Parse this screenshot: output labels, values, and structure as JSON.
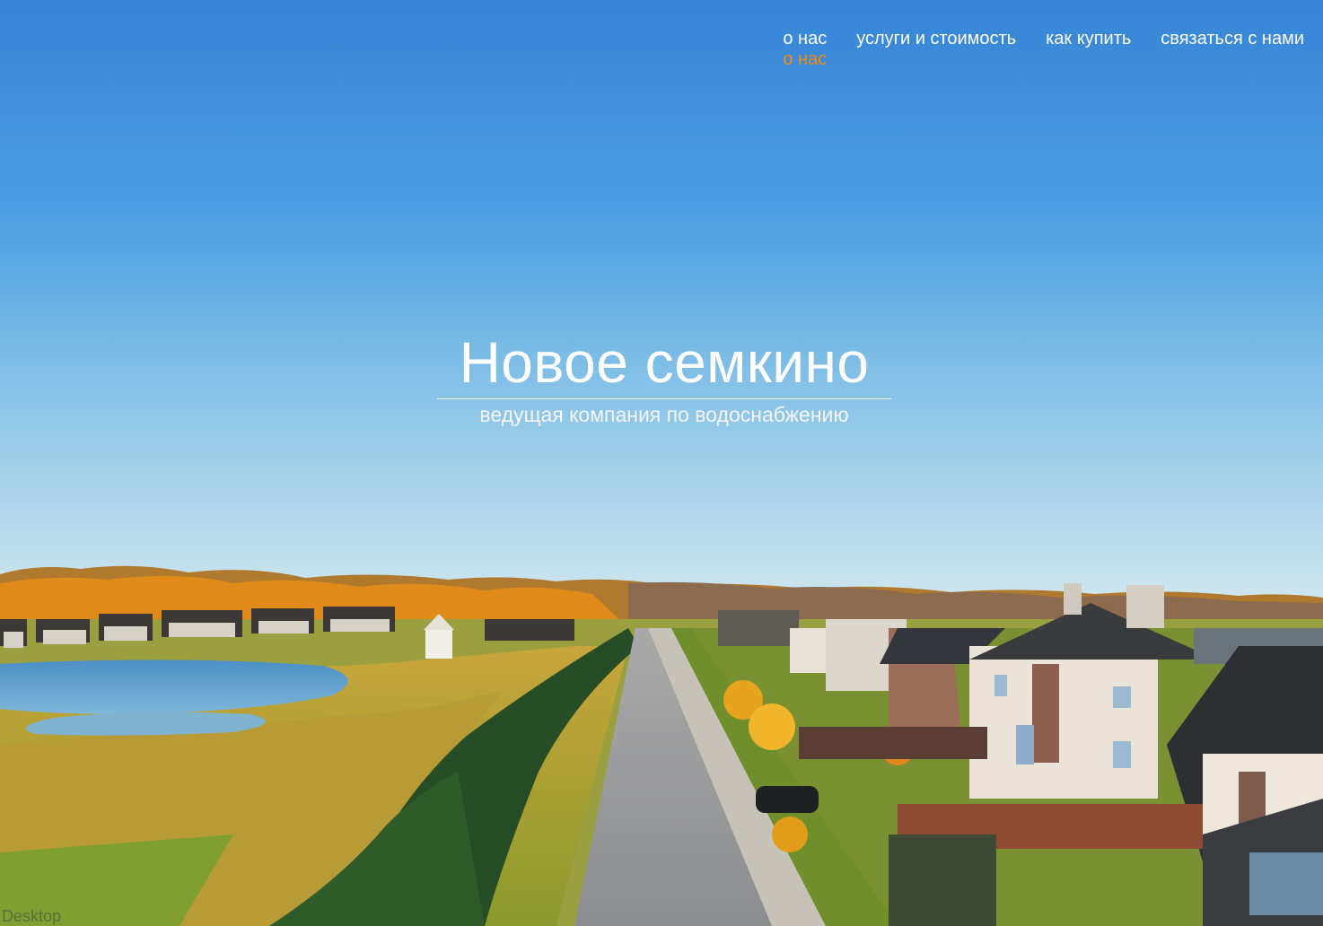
{
  "nav": {
    "items": [
      {
        "label": "о нас"
      },
      {
        "label": "услуги и стоимость"
      },
      {
        "label": "как купить"
      },
      {
        "label": "связаться с нами"
      }
    ],
    "hover_label": "о нас",
    "hover_color": "#f08a11"
  },
  "hero": {
    "title": "Новое семкино",
    "subtitle": "ведущая компания по водоснабжению",
    "image_description_icon": "aerial-village-photo"
  },
  "frame_label": "Desktop",
  "colors": {
    "sky_top": "#3a8bdc",
    "sky_bottom": "#b8d9ea",
    "accent": "#f08a11",
    "text": "#ffffff"
  }
}
